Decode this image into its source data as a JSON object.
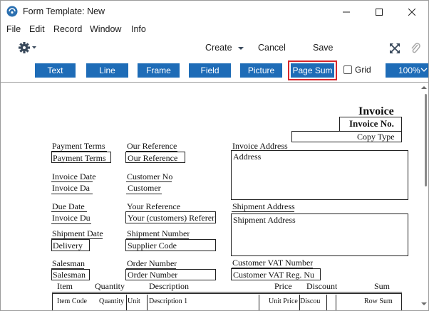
{
  "window": {
    "title": "Form Template: New"
  },
  "menu": [
    "File",
    "Edit",
    "Record",
    "Window",
    "Info"
  ],
  "toolbar": {
    "create": "Create",
    "cancel": "Cancel",
    "save": "Save"
  },
  "strip": {
    "buttons": [
      "Text",
      "Line",
      "Frame",
      "Field",
      "Picture",
      "Page Sum"
    ],
    "grid_label": "Grid",
    "zoom": "100%",
    "accent": "#1e6cb7",
    "highlight": "#d7262b"
  },
  "form": {
    "invoice_title": "Invoice",
    "invoice_no": "Invoice No.",
    "copy_type": "Copy Type",
    "payment_terms_label": "Payment Terms",
    "payment_terms_field": "Payment Terms",
    "our_reference_label": "Our Reference",
    "our_reference_field": "Our Reference",
    "invoice_address_label": "Invoice Address",
    "address_field": "Address",
    "invoice_date_label": "Invoice Date",
    "invoice_date_field": "Invoice Da",
    "customer_no_label": "Customer No",
    "customer_field": "Customer",
    "due_date_label": "Due Date",
    "due_date_field": "Invoice Du",
    "your_reference_label": "Your Reference",
    "your_reference_field": "Your (customers) Referen",
    "shipment_address_label": "Shipment Address",
    "shipment_address_field": "Shipment Address",
    "shipment_date_label": "Shipment Date",
    "delivery_field": "Delivery",
    "shipment_number_label": "Shipment Number",
    "supplier_code_field": "Supplier Code",
    "customer_vat_label": "Customer VAT Number",
    "customer_vat_field": "Customer VAT Reg. Nu",
    "salesman_label": "Salesman",
    "salesman_field": "Salesman",
    "order_number_label": "Order Number",
    "order_number_field": "Order Number"
  },
  "rows": {
    "headers": [
      "Item",
      "Quantity",
      "Description",
      "Price",
      "Discount",
      "Sum"
    ],
    "fields": [
      "Item Code",
      "Quantity",
      "Unit",
      "Unit Price",
      "Discou",
      "Row Sum",
      "Description 1"
    ]
  }
}
